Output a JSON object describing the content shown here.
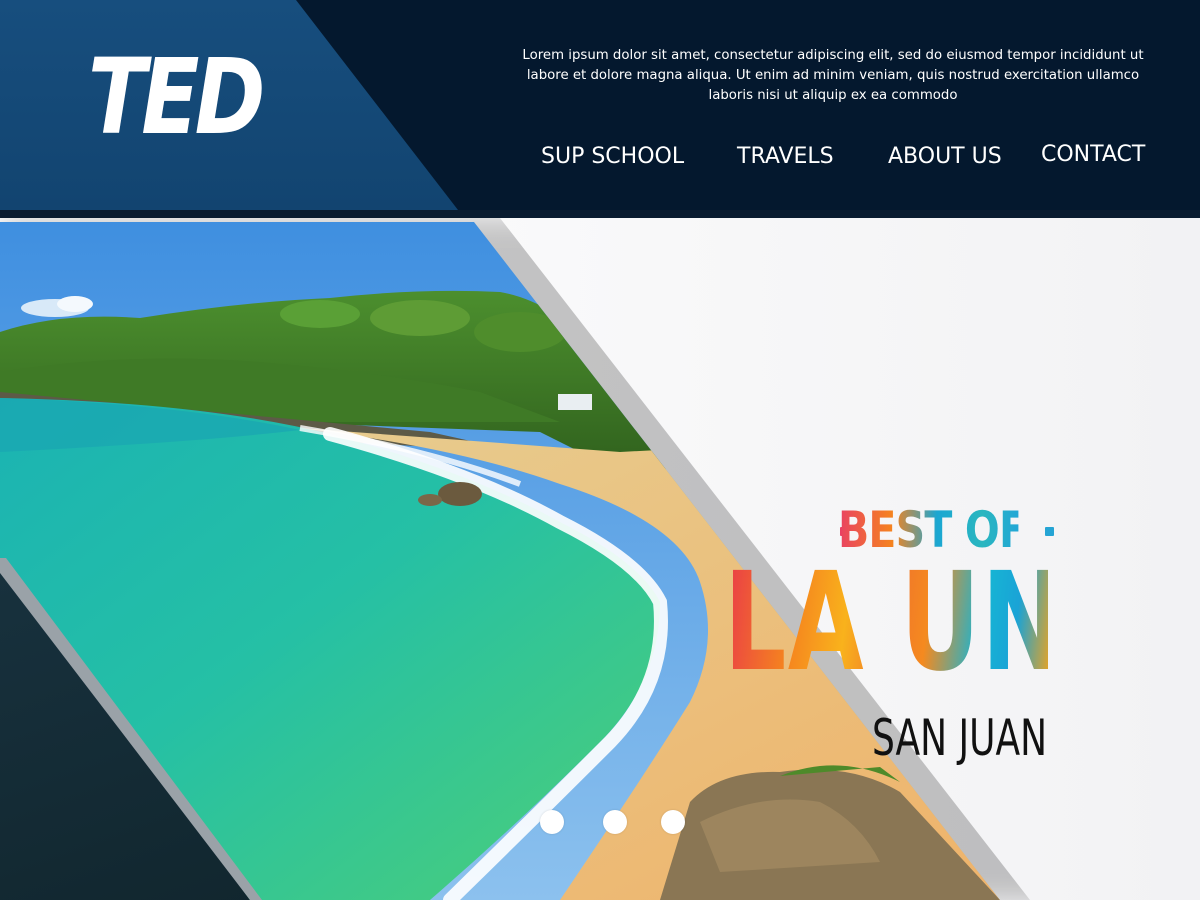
{
  "header": {
    "logo_text": "TED",
    "tagline": "Lorem ipsum dolor sit amet, consectetur adipiscing elit, sed do eiusmod tempor incididunt ut labore et dolore magna aliqua. Ut enim ad minim veniam, quis nostrud exercitation ullamco laboris nisi ut aliquip ex ea commodo",
    "nav": [
      {
        "label": "SUP SCHOOL"
      },
      {
        "label": "TRAVELS"
      },
      {
        "label": "ABOUT US"
      },
      {
        "label": "CONTACT"
      }
    ]
  },
  "hero": {
    "brand_top": "BEST OF",
    "brand_main": "LA UNION",
    "subtitle": "SAN JUAN",
    "carousel": {
      "slide_count": 3
    }
  },
  "colors": {
    "header_bg": "#04182e",
    "header_panel": "#174e7e",
    "text_light": "#ffffff",
    "subtitle_text": "#111111"
  }
}
